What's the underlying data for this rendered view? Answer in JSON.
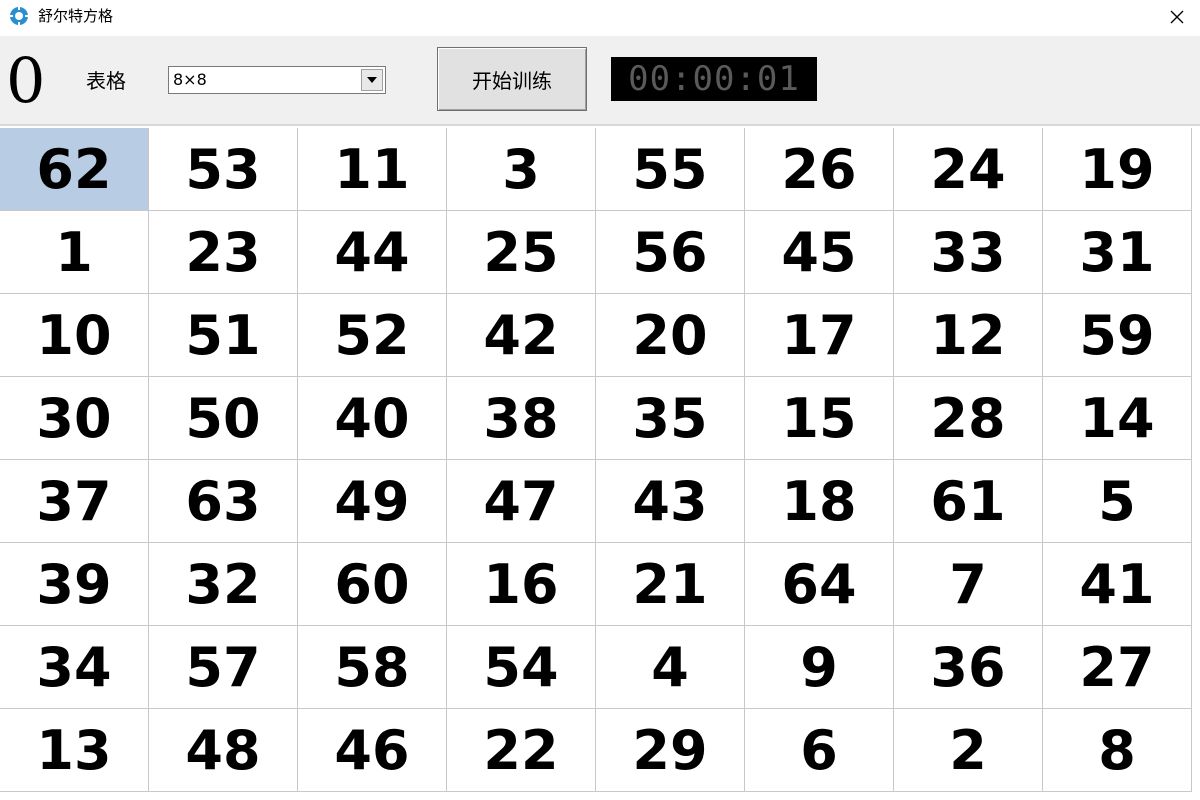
{
  "window": {
    "title": "舒尔特方格",
    "icon": "gear-like-app-icon",
    "close_symbol": "✕"
  },
  "toolbar": {
    "counter": "0",
    "table_label": "表格",
    "grid_size_value": "8×8",
    "start_button_label": "开始训练",
    "timer": "00:00:01"
  },
  "grid": {
    "selected_index": 0,
    "selected_color": "#b8cce4",
    "cells": [
      "62",
      "53",
      "11",
      "3",
      "55",
      "26",
      "24",
      "19",
      "1",
      "23",
      "44",
      "25",
      "56",
      "45",
      "33",
      "31",
      "10",
      "51",
      "52",
      "42",
      "20",
      "17",
      "12",
      "59",
      "30",
      "50",
      "40",
      "38",
      "35",
      "15",
      "28",
      "14",
      "37",
      "63",
      "49",
      "47",
      "43",
      "18",
      "61",
      "5",
      "39",
      "32",
      "60",
      "16",
      "21",
      "64",
      "7",
      "41",
      "34",
      "57",
      "58",
      "54",
      "4",
      "9",
      "36",
      "27",
      "13",
      "48",
      "46",
      "22",
      "29",
      "6",
      "2",
      "8"
    ]
  }
}
